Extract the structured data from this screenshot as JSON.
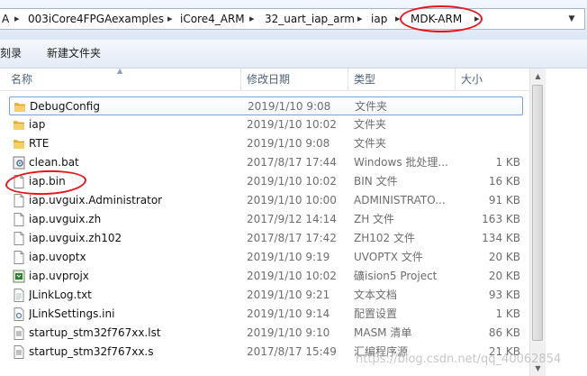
{
  "address": {
    "crumbs": [
      "A",
      "003iCore4FPGAexamples",
      "iCore4_ARM",
      "32_uart_iap_arm",
      "iap",
      "MDK-ARM"
    ],
    "separator": "▸",
    "dropdown_icon": "chevron-down-icon"
  },
  "toolbar": {
    "burn_label": "刻录",
    "new_folder_label": "新建文件夹"
  },
  "columns": {
    "name": "名称",
    "date": "修改日期",
    "type": "类型",
    "size": "大小"
  },
  "files": [
    {
      "name": "DebugConfig",
      "date": "2019/1/10 9:08",
      "type": "文件夹",
      "size": "",
      "icon": "folder-icon",
      "selected": true
    },
    {
      "name": "iap",
      "date": "2019/1/10 10:02",
      "type": "文件夹",
      "size": "",
      "icon": "folder-icon"
    },
    {
      "name": "RTE",
      "date": "2019/1/10 9:08",
      "type": "文件夹",
      "size": "",
      "icon": "folder-icon"
    },
    {
      "name": "clean.bat",
      "date": "2017/8/17 17:44",
      "type": "Windows 批处理...",
      "size": "1 KB",
      "icon": "batch-file-icon"
    },
    {
      "name": "iap.bin",
      "date": "2019/1/10 10:02",
      "type": "BIN 文件",
      "size": "16 KB",
      "icon": "file-icon"
    },
    {
      "name": "iap.uvguix.Administrator",
      "date": "2019/1/10 10:00",
      "type": "ADMINISTRATO...",
      "size": "91 KB",
      "icon": "file-icon"
    },
    {
      "name": "iap.uvguix.zh",
      "date": "2017/9/12 14:14",
      "type": "ZH 文件",
      "size": "163 KB",
      "icon": "file-icon"
    },
    {
      "name": "iap.uvguix.zh102",
      "date": "2017/8/17 17:42",
      "type": "ZH102 文件",
      "size": "134 KB",
      "icon": "file-icon"
    },
    {
      "name": "iap.uvoptx",
      "date": "2019/1/10 9:19",
      "type": "UVOPTX 文件",
      "size": "20 KB",
      "icon": "file-icon"
    },
    {
      "name": "iap.uvprojx",
      "date": "2019/1/10 10:02",
      "type": "礦ision5 Project",
      "size": "20 KB",
      "icon": "keil-project-icon"
    },
    {
      "name": "JLinkLog.txt",
      "date": "2019/1/10 9:21",
      "type": "文本文档",
      "size": "93 KB",
      "icon": "text-file-icon"
    },
    {
      "name": "JLinkSettings.ini",
      "date": "2019/1/10 9:14",
      "type": "配置设置",
      "size": "1 KB",
      "icon": "settings-file-icon"
    },
    {
      "name": "startup_stm32f767xx.lst",
      "date": "2019/1/10 9:10",
      "type": "MASM 清单",
      "size": "86 KB",
      "icon": "list-file-icon"
    },
    {
      "name": "startup_stm32f767xx.s",
      "date": "2017/8/17 15:49",
      "type": "汇编程序源",
      "size": "21 KB",
      "icon": "list-file-icon"
    }
  ],
  "watermark": "https://blog.csdn.net/qq_40062854",
  "colors": {
    "annotation": "#e8141b",
    "selection_border": "#7da2ce",
    "header_text": "#4c607a"
  }
}
